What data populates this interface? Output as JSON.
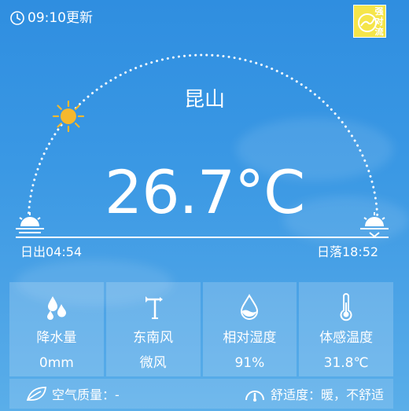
{
  "header": {
    "update_time": "09:10更新",
    "badge_text": "强对流"
  },
  "main": {
    "city": "昆山",
    "temperature": "26.7°C",
    "sunrise": "日出04:54",
    "sunset": "日落18:52",
    "sun_progress": 0.22
  },
  "tiles": [
    {
      "label": "降水量",
      "value": "0mm",
      "icon": "raindrops-icon"
    },
    {
      "label": "东南风",
      "value": "微风",
      "icon": "wind-vane-icon"
    },
    {
      "label": "相对湿度",
      "value": "91%",
      "icon": "humidity-drop-icon"
    },
    {
      "label": "体感温度",
      "value": "31.8℃",
      "icon": "thermometer-icon"
    }
  ],
  "bottom": {
    "air_quality": "空气质量：-",
    "comfort": "舒适度：暖，不舒适"
  },
  "colors": {
    "badge": "#f5e54a",
    "sun": "#f5b82e"
  }
}
